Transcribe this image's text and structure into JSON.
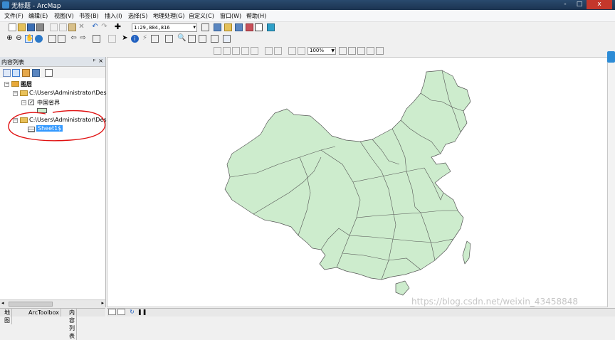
{
  "window": {
    "title": "无标题 - ArcMap",
    "min": "-",
    "max": "□",
    "close": "x"
  },
  "menu": [
    "文件(F)",
    "编辑(E)",
    "视图(V)",
    "书签(B)",
    "插入(I)",
    "选择(S)",
    "地理处理(G)",
    "自定义(C)",
    "窗口(W)",
    "帮助(H)"
  ],
  "toolbar": {
    "scale": "1:29,884,816",
    "zoom": "100%"
  },
  "toc": {
    "title": "内容列表",
    "pin": "ᵖ",
    "close": "×",
    "root_label": "图层",
    "folder1": "C:\\Users\\Administrator\\Desk",
    "layer1": "中国省界",
    "folder2": "C:\\Users\\Administrator\\Desk",
    "table1": "Sheet1$"
  },
  "tabs": [
    "地图",
    "ArcToolbox",
    "内容列表"
  ],
  "colors": {
    "map_fill": "#cdeccd",
    "map_stroke": "#555555",
    "annotation": "#e01010",
    "selection": "#3399ff"
  },
  "watermark": "https://blog.csdn.net/weixin_43458848"
}
